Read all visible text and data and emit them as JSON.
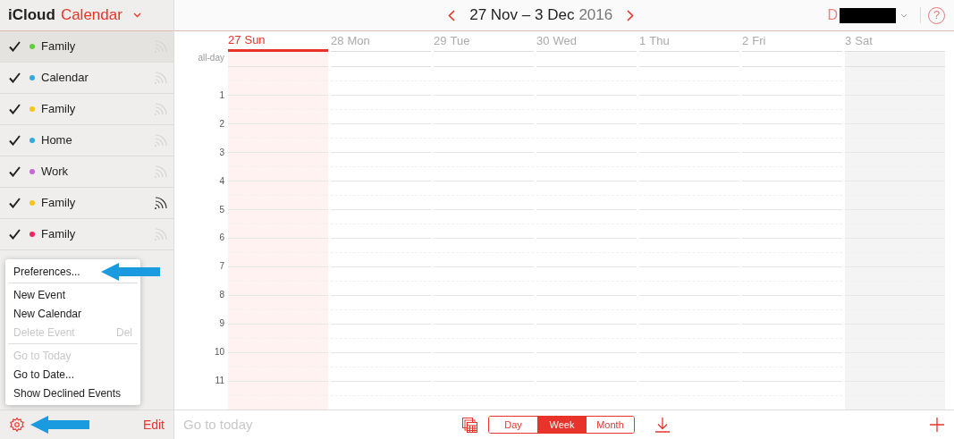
{
  "app": {
    "brand": "iCloud",
    "name": "Calendar"
  },
  "calendars": [
    {
      "name": "Family",
      "color": "#5fcf3a",
      "checked": true,
      "selected": true,
      "shared": false
    },
    {
      "name": "Calendar",
      "color": "#34a9e0",
      "checked": true,
      "selected": false,
      "shared": false
    },
    {
      "name": "Family",
      "color": "#fcc419",
      "checked": true,
      "selected": false,
      "shared": false
    },
    {
      "name": "Home",
      "color": "#34a9e0",
      "checked": true,
      "selected": false,
      "shared": false
    },
    {
      "name": "Work",
      "color": "#c767d9",
      "checked": true,
      "selected": false,
      "shared": false
    },
    {
      "name": "Family",
      "color": "#fcc419",
      "checked": true,
      "selected": false,
      "shared": true
    },
    {
      "name": "Family",
      "color": "#f0245e",
      "checked": true,
      "selected": false,
      "shared": false
    }
  ],
  "menu": [
    {
      "label": "Preferences...",
      "disabled": false,
      "divider_after": true
    },
    {
      "label": "New Event",
      "disabled": false,
      "divider_after": false
    },
    {
      "label": "New Calendar",
      "disabled": false,
      "divider_after": false
    },
    {
      "label": "Delete Event",
      "shortcut": "Del",
      "disabled": true,
      "divider_after": true
    },
    {
      "label": "Go to Today",
      "disabled": true,
      "divider_after": false
    },
    {
      "label": "Go to Date...",
      "disabled": false,
      "divider_after": false
    },
    {
      "label": "Show Declined Events",
      "disabled": false,
      "divider_after": false
    }
  ],
  "sidebar_footer": {
    "edit": "Edit"
  },
  "header": {
    "range": "27 Nov – 3 Dec",
    "year": "2016",
    "user": "D",
    "help": "?"
  },
  "days": [
    {
      "date": "27",
      "name": "Sun",
      "kind": "today"
    },
    {
      "date": "28",
      "name": "Mon",
      "kind": "weekday"
    },
    {
      "date": "29",
      "name": "Tue",
      "kind": "weekday"
    },
    {
      "date": "30",
      "name": "Wed",
      "kind": "weekday"
    },
    {
      "date": "1",
      "name": "Thu",
      "kind": "weekday"
    },
    {
      "date": "2",
      "name": "Fri",
      "kind": "weekday"
    },
    {
      "date": "3",
      "name": "Sat",
      "kind": "weekend"
    }
  ],
  "all_day_label": "all-day",
  "hours": [
    "1",
    "2",
    "3",
    "4",
    "5",
    "6",
    "7",
    "8",
    "9",
    "10",
    "11"
  ],
  "footer": {
    "goto": "Go to today",
    "views": [
      {
        "label": "Day",
        "selected": false
      },
      {
        "label": "Week",
        "selected": true
      },
      {
        "label": "Month",
        "selected": false
      }
    ]
  }
}
